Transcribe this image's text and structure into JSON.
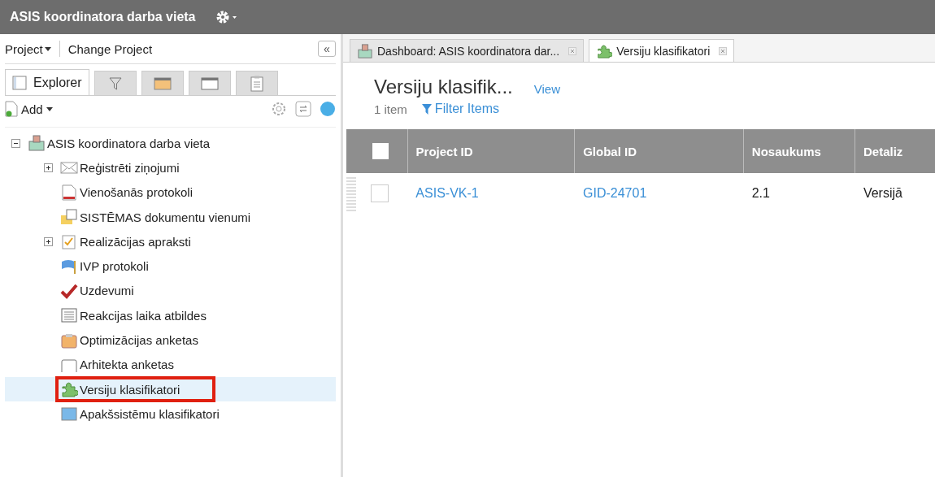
{
  "header": {
    "title": "ASIS koordinatora darba vieta"
  },
  "sidebar": {
    "project_menu": "Project",
    "change_project": "Change Project",
    "collapse": "«",
    "tabs": [
      {
        "kind": "explorer",
        "label": "Explorer",
        "selected": true
      },
      {
        "kind": "filter",
        "selected": false
      },
      {
        "kind": "grid",
        "selected": false
      },
      {
        "kind": "window",
        "selected": false
      },
      {
        "kind": "clipboard",
        "selected": false
      }
    ],
    "add": "Add",
    "tree": [
      {
        "label": "ASIS koordinatora darba vieta",
        "kind": "project",
        "expanded": true,
        "selected": false,
        "marked": false,
        "children": [
          {
            "label": "Reģistrēti ziņojumi",
            "kind": "mail",
            "expanded": false,
            "selected": false,
            "marked": false
          },
          {
            "label": "Vienošanās protokoli",
            "kind": "doc",
            "selected": false,
            "marked": false
          },
          {
            "label": "SISTĒMAS dokumentu vienumi",
            "kind": "folder",
            "selected": false,
            "marked": false
          },
          {
            "label": "Realizācijas apraksti",
            "kind": "note",
            "expanded": false,
            "selected": false,
            "marked": false
          },
          {
            "label": "IVP protokoli",
            "kind": "flag",
            "selected": false,
            "marked": false
          },
          {
            "label": "Uzdevumi",
            "kind": "check",
            "selected": false,
            "marked": false
          },
          {
            "label": "Reakcijas laika atbildes",
            "kind": "list",
            "selected": false,
            "marked": false
          },
          {
            "label": "Optimizācijas anketas",
            "kind": "clipboard",
            "selected": false,
            "marked": false
          },
          {
            "label": "Arhitekta anketas",
            "kind": "clipboard-empty",
            "selected": false,
            "marked": false
          },
          {
            "label": "Versiju klasifikatori",
            "kind": "puzzle",
            "selected": true,
            "marked": true
          },
          {
            "label": "Apakšsistēmu klasifikatori",
            "kind": "window",
            "selected": false,
            "marked": false
          }
        ]
      }
    ]
  },
  "doc_tabs": [
    {
      "label": "Dashboard: ASIS koordinatora dar...",
      "kind": "project",
      "selected": false
    },
    {
      "label": "Versiju klasifikatori",
      "kind": "puzzle",
      "selected": true
    }
  ],
  "content": {
    "title": "Versiju klasifik...",
    "view": "View",
    "count": "1 item",
    "filter": "Filter Items",
    "table": {
      "select_all_checked": false,
      "columns": [
        "Project ID",
        "Global ID",
        "Nosaukums",
        "Detaliz"
      ],
      "rows": [
        {
          "checked": false,
          "cells": [
            "ASIS-VK-1",
            "GID-24701",
            "2.1",
            "Versijā"
          ],
          "links": [
            true,
            true,
            false,
            false
          ]
        }
      ]
    }
  }
}
